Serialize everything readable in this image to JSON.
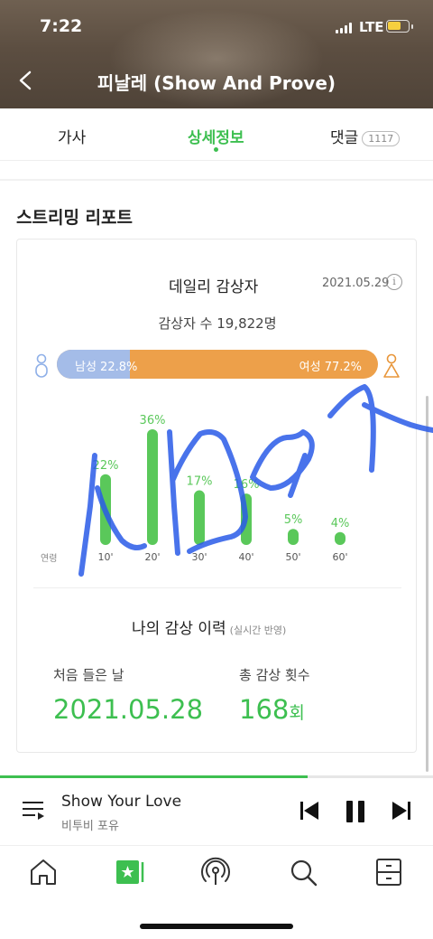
{
  "status_bar": {
    "time": "7:22",
    "network": "LTE"
  },
  "header": {
    "title": "피날레 (Show And Prove)"
  },
  "tabs": [
    {
      "label": "가사"
    },
    {
      "label": "상세정보",
      "active": true
    },
    {
      "label": "댓글",
      "badge": "1117"
    }
  ],
  "section_title": "스트리밍 리포트",
  "daily": {
    "title": "데일리 감상자",
    "date": "2021.05.29",
    "info_icon": "i",
    "listeners": "감상자 수 19,822명",
    "male_label": "남성 22.8%",
    "female_label": "여성 77.2%",
    "male_share": 0.228
  },
  "chart_data": {
    "type": "bar",
    "categories": [
      "10'",
      "20'",
      "30'",
      "40'",
      "50'",
      "60'"
    ],
    "values": [
      22,
      36,
      17,
      16,
      5,
      4
    ],
    "value_labels": [
      "22%",
      "36%",
      "17%",
      "16%",
      "5%",
      "4%"
    ],
    "xlabel": "연령",
    "ylabel": "",
    "ylim": [
      0,
      36
    ],
    "bar_color": "#5ac85a"
  },
  "history": {
    "title": "나의 감상 이력",
    "note": "(실시간 반영)",
    "first_label": "처음 들은 날",
    "first_value": "2021.05.28",
    "total_label": "총 감상 횟수",
    "total_value": "168",
    "total_unit": "회"
  },
  "player": {
    "song": "Show Your Love",
    "artist": "비투비 포유",
    "progress": 0.71
  },
  "nav": [
    "home-icon",
    "music-card-icon",
    "podcast-icon",
    "search-icon",
    "storage-icon"
  ],
  "colors": {
    "accent": "#3dbf50",
    "male": "#a4bce8",
    "female": "#eda04a",
    "scribble": "#2a5be8"
  }
}
